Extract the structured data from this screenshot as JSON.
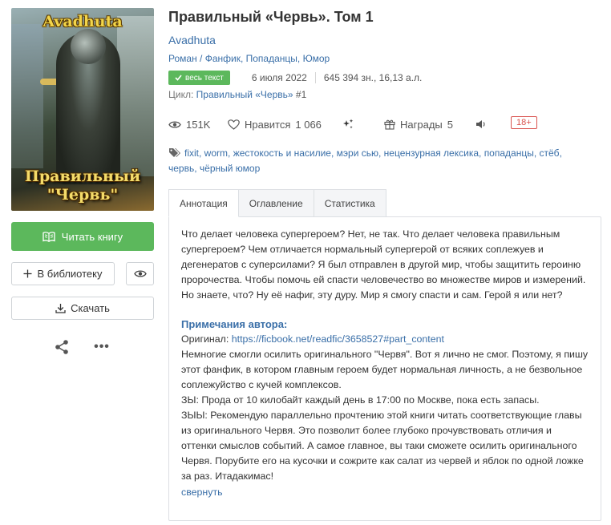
{
  "cover": {
    "author_text": "Avadhuta",
    "title_line1": "Правильный",
    "title_line2": "\"Червь\""
  },
  "actions": {
    "read_label": "Читать книгу",
    "library_label": "В библиотеку",
    "download_label": "Скачать",
    "more_label": "•••"
  },
  "book": {
    "title": "Правильный «Червь». Том 1",
    "author": "Avadhuta",
    "genres": [
      "Роман / Фанфик",
      "Попаданцы",
      "Юмор"
    ],
    "status_badge": "весь текст",
    "date": "6 июля 2022",
    "size": "645 394 зн., 16,13 а.л.",
    "cycle_label": "Цикл:",
    "cycle_name": "Правильный «Червь»",
    "cycle_number": "#1"
  },
  "stats": {
    "views": "151K",
    "likes_label": "Нравится",
    "likes_count": "1 066",
    "awards_label": "Награды",
    "awards_count": "5",
    "age_rating": "18+"
  },
  "tags": [
    "fixit",
    "worm",
    "жестокость и насилие",
    "мэри сью",
    "нецензурная лексика",
    "попаданцы",
    "стёб",
    "червь",
    "чёрный юмор"
  ],
  "tabs": [
    {
      "label": "Аннотация",
      "active": true
    },
    {
      "label": "Оглавление",
      "active": false
    },
    {
      "label": "Статистика",
      "active": false
    }
  ],
  "annotation": {
    "text": "Что делает человека супергероем? Нет, не так. Что делает человека правильным супергероем? Чем отличается нормальный супергерой от всяких соплежуев и дегенератов с суперсилами? Я был отправлен в другой мир, чтобы защитить героиню пророчества. Чтобы помочь ей спасти человечество во множестве миров и измерений. Но знаете, что? Ну её нафиг, эту дуру. Мир я смогу спасти и сам. Герой я или нет?",
    "notes_title": "Примечания автора:",
    "original_label": "Оригинал:",
    "original_link": "https://ficbook.net/readfic/3658527#part_content",
    "notes_p1": "Немногие смогли осилить оригинального \"Червя\". Вот я лично не смог. Поэтому, я пишу этот фанфик, в котором главным героем будет нормальная личность, а не безвольное соплежуйство с кучей комплексов.",
    "notes_p2": "ЗЫ: Прода от 10 килобайт каждый день в 17:00 по Москве, пока есть запасы.",
    "notes_p3": "ЗЫЫ: Рекомендую параллельно прочтению этой книги читать соответствующие главы из оригинального Червя. Это позволит более глубоко прочувствовать отличия и оттенки смыслов событий. А самое главное, вы таки сможете осилить оригинального Червя. Порубите его на кусочки и сожрите как салат из червей и яблок по одной ложке за раз. Итадакимас!",
    "collapse_label": "свернуть"
  },
  "colors": {
    "accent_green": "#5cb85c",
    "link_blue": "#3a6fa8",
    "age_red": "#d9534f"
  }
}
